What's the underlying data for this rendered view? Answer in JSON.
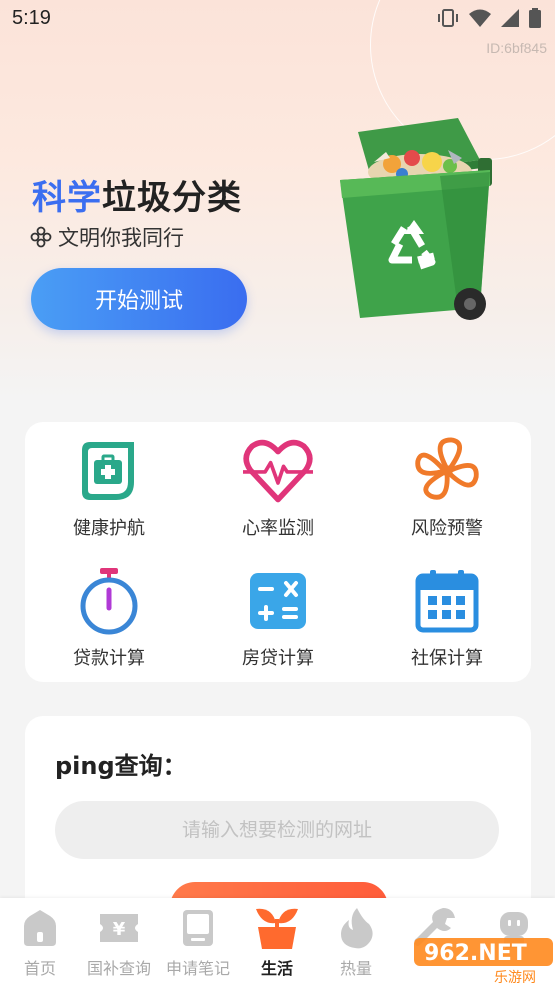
{
  "status": {
    "time": "5:19"
  },
  "hero": {
    "id_label": "ID:6bf845",
    "title_highlight": "科学",
    "title_rest": "垃圾分类",
    "subtitle": "文明你我同行",
    "start_button": "开始测试"
  },
  "tools": [
    {
      "label": "健康护航",
      "icon": "medical-kit-icon",
      "color": "#2aa88a"
    },
    {
      "label": "心率监测",
      "icon": "heart-rate-icon",
      "color": "#e0357a"
    },
    {
      "label": "风险预警",
      "icon": "fan-icon",
      "color": "#f07a2a"
    },
    {
      "label": "贷款计算",
      "icon": "stopwatch-icon",
      "color": "#3a86d6"
    },
    {
      "label": "房贷计算",
      "icon": "calculator-icon",
      "color": "#3aa6e8"
    },
    {
      "label": "社保计算",
      "icon": "calendar-icon",
      "color": "#2a8ee0"
    }
  ],
  "ping": {
    "title": "ping查询：",
    "placeholder": "请输入想要检测的网址"
  },
  "tabs": [
    {
      "label": "首页",
      "icon": "home-icon",
      "active": false
    },
    {
      "label": "国补查询",
      "icon": "ticket-yen-icon",
      "active": false
    },
    {
      "label": "申请笔记",
      "icon": "notebook-icon",
      "active": false
    },
    {
      "label": "生活",
      "icon": "sprout-pot-icon",
      "active": true
    },
    {
      "label": "热量",
      "icon": "flame-icon",
      "active": false
    },
    {
      "label": "",
      "icon": "wrench-icon",
      "active": false
    },
    {
      "label": "",
      "icon": "robot-icon",
      "active": false
    }
  ],
  "watermark": {
    "text": "962.NET",
    "subtext": "乐游网"
  }
}
